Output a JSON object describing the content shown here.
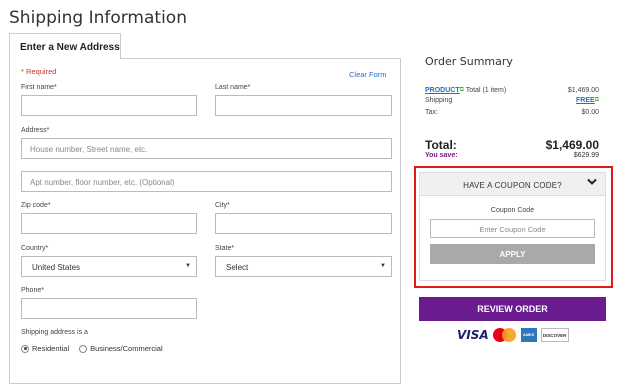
{
  "page": {
    "title": "Shipping Information"
  },
  "tabs": {
    "active": "Enter a New Address"
  },
  "form": {
    "required_note": "* Required",
    "clear_form": "Clear Form",
    "first_name_label": "First name*",
    "last_name_label": "Last name*",
    "address_label": "Address*",
    "address_placeholder": "House number, Street name, etc.",
    "address2_placeholder": "Apt number, floor number, etc. (Optional)",
    "zip_label": "Zip code*",
    "city_label": "City*",
    "country_label": "Country*",
    "country_value": "United States",
    "state_label": "State*",
    "state_value": "Select",
    "phone_label": "Phone*",
    "shipping_type_label": "Shipping address is a",
    "shipping_types": [
      "Residential",
      "Business/Commercial"
    ],
    "shipping_type_selected": "Residential"
  },
  "summary": {
    "title": "Order Summary",
    "product_link": "PRODUCT",
    "product_text": "Total (1 item)",
    "product_price": "$1,469.00",
    "shipping_label": "Shipping",
    "shipping_value": "FREE",
    "tax_label": "Tax:",
    "tax_value": "$0.00",
    "total_label": "Total:",
    "total_value": "$1,469.00",
    "save_label": "You save:",
    "save_value": "$629.99"
  },
  "coupon": {
    "header": "HAVE A COUPON CODE?",
    "label": "Coupon Code",
    "placeholder": "Enter Coupon Code",
    "apply": "APPLY"
  },
  "checkout": {
    "review_button": "REVIEW ORDER"
  },
  "payment_cards": {
    "visa": "VISA",
    "amex": "AMEX",
    "discover": "DISCOVER"
  },
  "colors": {
    "accent_purple": "#6a1b8f",
    "highlight_red": "#e0191b",
    "link_blue": "#2a6ebb"
  }
}
